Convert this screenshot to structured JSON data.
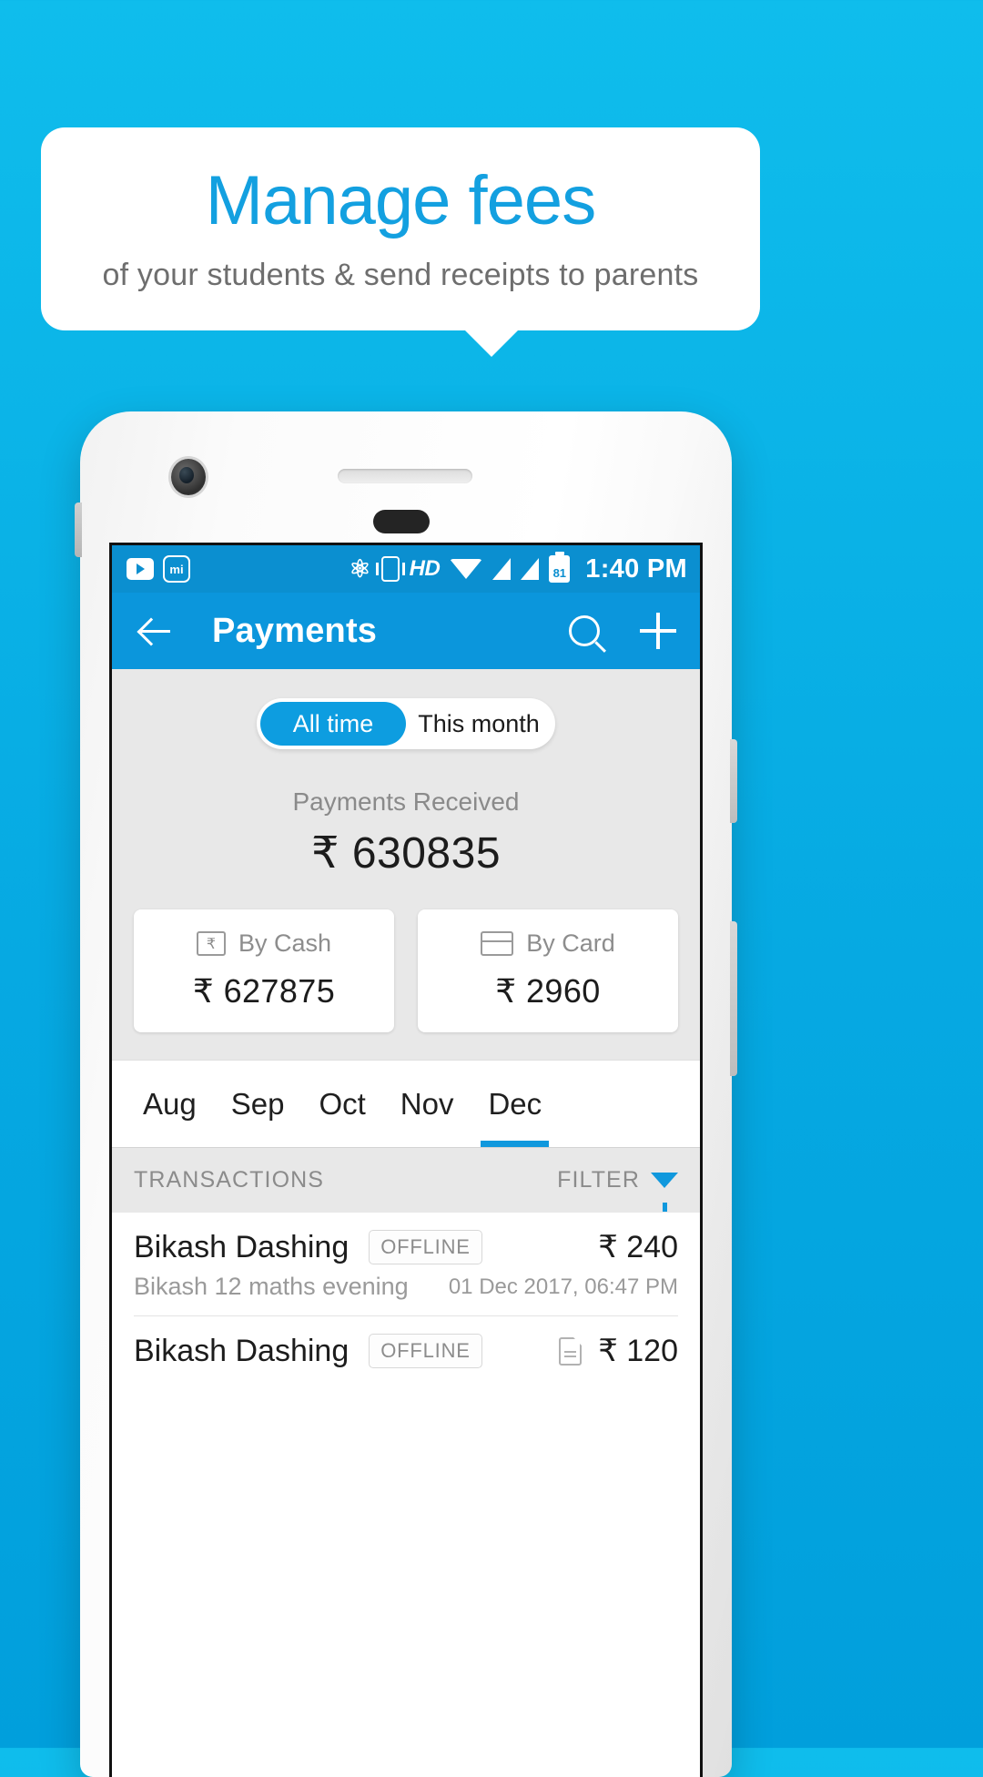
{
  "promo": {
    "title": "Manage fees",
    "subtitle": "of your students & send receipts to parents"
  },
  "statusbar": {
    "icons": [
      "play-icon",
      "mi-icon",
      "bluetooth-icon",
      "vibrate-icon",
      "hd-icon",
      "wifi-icon",
      "signal-icon",
      "signal-icon"
    ],
    "hd_label": "HD",
    "battery_level": "81",
    "time": "1:40 PM"
  },
  "appbar": {
    "back": "back-arrow-icon",
    "title": "Payments",
    "search": "search-icon",
    "add": "plus-icon"
  },
  "segmented": {
    "options": [
      {
        "label": "All time",
        "selected": true
      },
      {
        "label": "This month",
        "selected": false
      }
    ]
  },
  "summary": {
    "received_label": "Payments Received",
    "received_amount": "₹ 630835",
    "cards": [
      {
        "label": "By Cash",
        "amount": "₹ 627875",
        "icon": "rupee-box-icon"
      },
      {
        "label": "By Card",
        "amount": "₹ 2960",
        "icon": "credit-card-icon"
      }
    ]
  },
  "months": {
    "items": [
      "Aug",
      "Sep",
      "Oct",
      "Nov",
      "Dec"
    ],
    "active": "Dec"
  },
  "transactions_header": {
    "title": "TRANSACTIONS",
    "filter_label": "FILTER",
    "filter_icon": "funnel-icon"
  },
  "transactions": [
    {
      "name": "Bikash Dashing",
      "badge": "OFFLINE",
      "amount": "₹ 240",
      "description": "Bikash 12 maths evening",
      "date": "01 Dec 2017, 06:47 PM",
      "has_receipt": false
    },
    {
      "name": "Bikash Dashing",
      "badge": "OFFLINE",
      "amount": "₹ 120",
      "description": "",
      "date": "",
      "has_receipt": true
    }
  ],
  "colors": {
    "brand": "#0b96dc",
    "background": "#06a9e2",
    "accent": "#13a0e0",
    "surface": "#e8e8e8"
  }
}
